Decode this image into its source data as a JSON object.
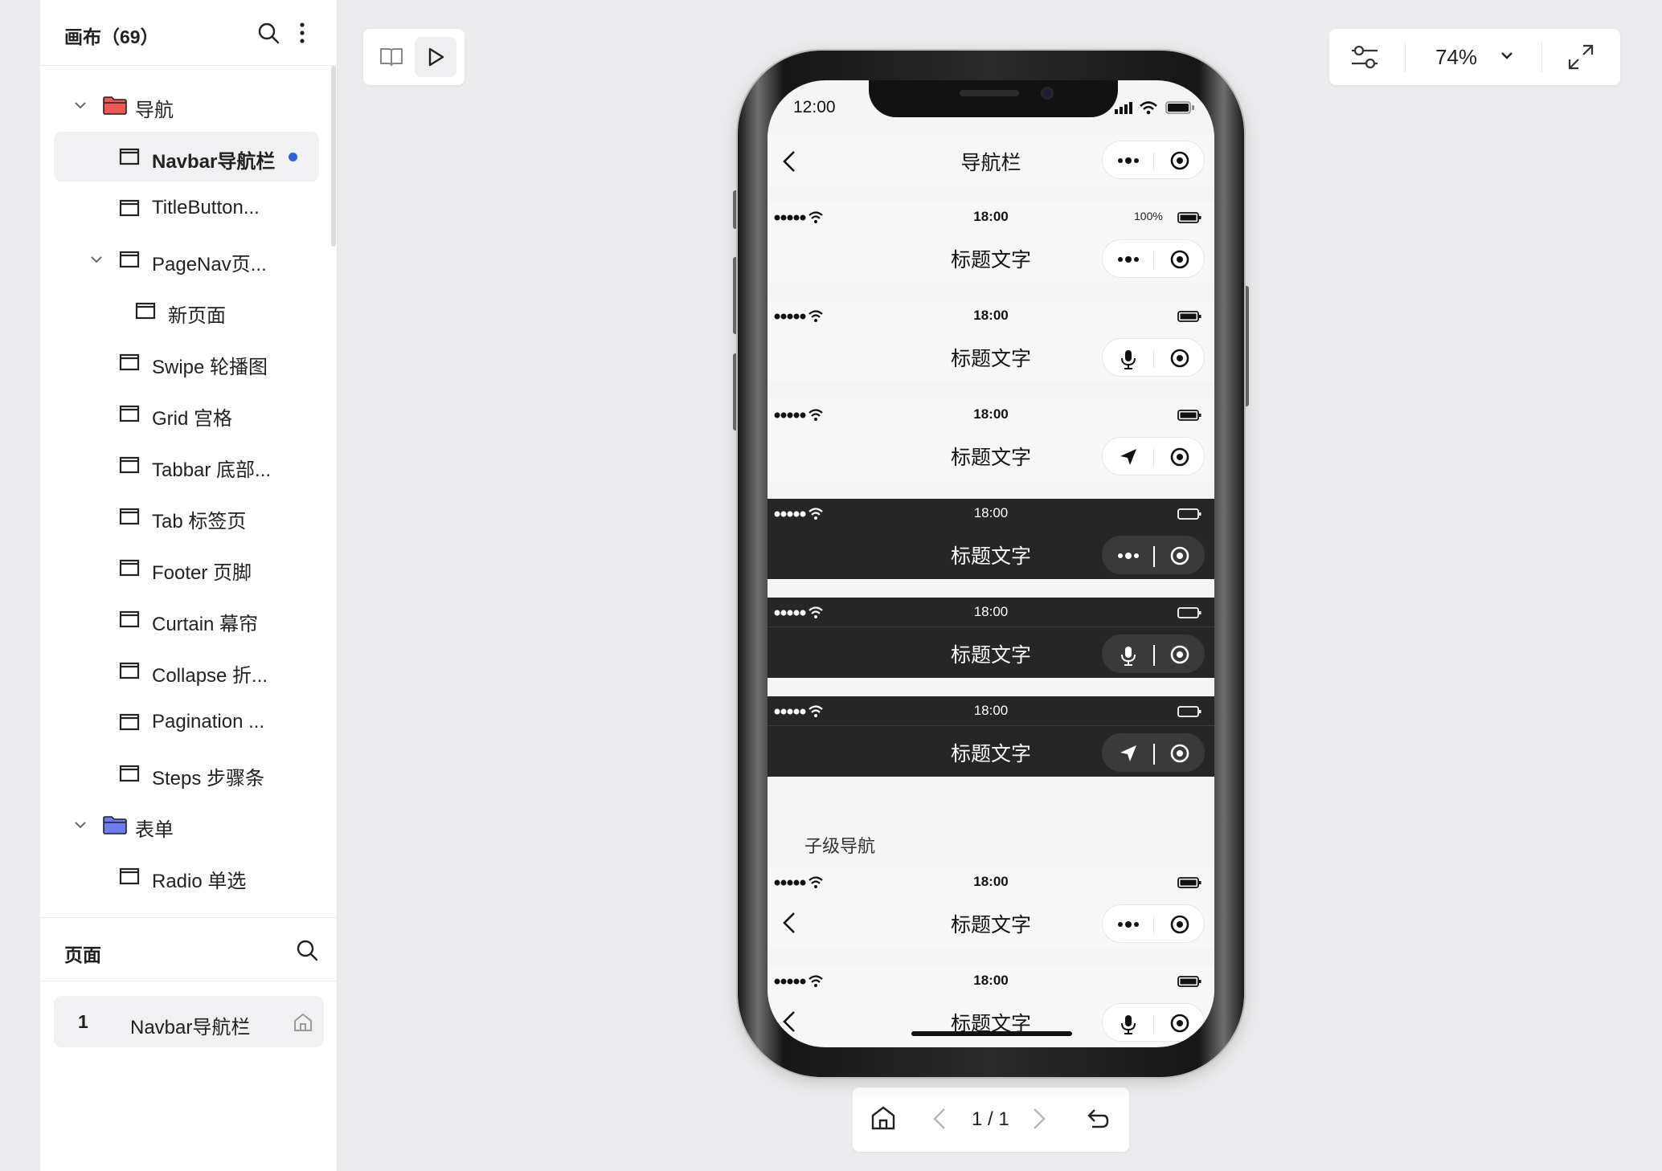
{
  "sidebar": {
    "title": "画布（69）",
    "tree": [
      {
        "label": "导航",
        "type": "folder",
        "color": "#e8483f"
      },
      {
        "label": "Navbar导航栏",
        "type": "page",
        "active": true
      },
      {
        "label": "TitleButton...",
        "type": "page"
      },
      {
        "label": "PageNav页...",
        "type": "page"
      },
      {
        "label": "新页面",
        "type": "page"
      },
      {
        "label": "Swipe 轮播图",
        "type": "page"
      },
      {
        "label": "Grid 宫格",
        "type": "page"
      },
      {
        "label": "Tabbar 底部...",
        "type": "page"
      },
      {
        "label": "Tab 标签页",
        "type": "page"
      },
      {
        "label": "Footer 页脚",
        "type": "page"
      },
      {
        "label": "Curtain 幕帘",
        "type": "page"
      },
      {
        "label": "Collapse 折...",
        "type": "page"
      },
      {
        "label": "Pagination ...",
        "type": "page"
      },
      {
        "label": "Steps 步骤条",
        "type": "page"
      },
      {
        "label": "表单",
        "type": "folder",
        "color": "#5b6ee8"
      },
      {
        "label": "Radio 单选",
        "type": "page"
      }
    ],
    "pages_title": "页面",
    "pages": [
      {
        "num": "1",
        "name": "Navbar导航栏"
      }
    ]
  },
  "zoom": {
    "value": "74%"
  },
  "pager": {
    "text": "1 / 1"
  },
  "phone": {
    "status_time": "12:00",
    "main_title": "导航栏",
    "bar_time": "18:00",
    "battery_pct": "100%",
    "bar_title": "标题文字",
    "section_label": "子级导航"
  },
  "colors": {
    "accent_blue": "#2a63db",
    "dark_bar": "#262626",
    "light_bar": "#f7f7f7"
  }
}
